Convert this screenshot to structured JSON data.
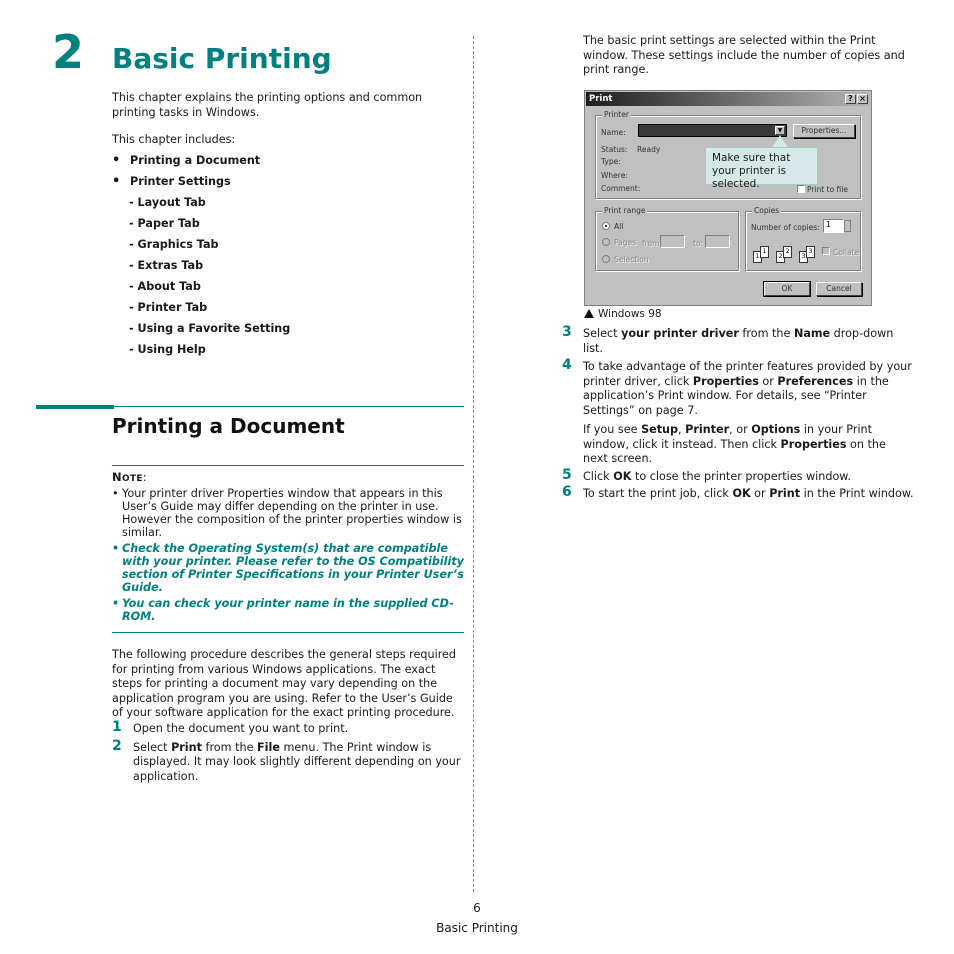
{
  "chapter": {
    "number": "2",
    "title": "Basic Printing",
    "intro": "This chapter explains the printing options and common printing tasks in Windows.",
    "includes_label": "This chapter includes:",
    "toc": [
      {
        "label": "Printing a Document",
        "level": 1
      },
      {
        "label": "Printer Settings",
        "level": 1
      },
      {
        "label": "- Layout Tab",
        "level": 2
      },
      {
        "label": "- Paper Tab",
        "level": 2
      },
      {
        "label": "- Graphics Tab",
        "level": 2
      },
      {
        "label": "- Extras Tab",
        "level": 2
      },
      {
        "label": "- About Tab",
        "level": 2
      },
      {
        "label": "- Printer Tab",
        "level": 2
      },
      {
        "label": "- Using a Favorite Setting",
        "level": 2
      },
      {
        "label": "- Using Help",
        "level": 2
      }
    ]
  },
  "section": {
    "title": "Printing a Document",
    "note": {
      "label_first": "N",
      "label_rest": "OTE",
      "label_colon": ":",
      "items": [
        {
          "text": "Your printer driver Properties window that appears in this User’s Guide may differ depending on the printer in use. However the composition of the printer properties window is similar.",
          "emphasis": false
        },
        {
          "text": "Check the Operating System(s) that are compatible with your printer. Please refer to the OS Compatibility section of Printer Specifications in your Printer User’s Guide.",
          "emphasis": true
        },
        {
          "text": "You can check your printer name in the supplied CD-ROM.",
          "emphasis": true
        }
      ]
    },
    "procedure_intro": "The following procedure describes the general steps required for printing from various Windows applications. The exact steps for printing a document may vary depending on the application program you are using. Refer to the User’s Guide of your software application for the exact printing procedure.",
    "steps": {
      "s1": {
        "num": "1",
        "text": "Open the document you want to print."
      },
      "s2": {
        "num": "2",
        "a": "Select ",
        "b": "Print",
        "c": " from the ",
        "d": "File",
        "e": " menu. The Print window is displayed. It may look slightly different depending on your application."
      },
      "s3": {
        "num": "3",
        "a": "Select ",
        "b": "your printer driver",
        "c": " from the ",
        "d": "Name",
        "e": " drop-down list."
      },
      "s4": {
        "num": "4",
        "a": "To take advantage of the printer features provided by your printer driver, click ",
        "b": "Properties",
        "c": " or ",
        "d": "Preferences",
        "e": " in the application’s Print window. For details, see “Printer Settings” on page 7."
      },
      "s4b": {
        "a": "If you see ",
        "b": "Setup",
        "c": ", ",
        "d": "Printer",
        "e": ", or ",
        "f": "Options",
        "g": " in your Print window, click it instead. Then click ",
        "h": "Properties",
        "i": " on the next screen."
      },
      "s5": {
        "num": "5",
        "a": "Click ",
        "b": "OK",
        "c": " to close the printer properties window."
      },
      "s6": {
        "num": "6",
        "a": "To start the print job, click ",
        "b": "OK",
        "c": " or ",
        "d": "Print",
        "e": " in the Print window."
      }
    }
  },
  "right_intro": "The basic print settings are selected within the Print window. These settings include the number of copies and print range.",
  "dialog": {
    "title": "Print",
    "help_btn": "?",
    "close_btn": "×",
    "printer_group": "Printer",
    "name_label": "Name:",
    "properties_btn": "Properties...",
    "status_label": "Status:",
    "status_value": "Ready",
    "type_label": "Type:",
    "where_label": "Where:",
    "comment_label": "Comment:",
    "print_to_file": "Print to file",
    "range_group": "Print range",
    "range_all": "All",
    "range_pages": "Pages",
    "from_label": "from:",
    "to_label": "to:",
    "range_selection": "Selection",
    "copies_group": "Copies",
    "copies_label": "Number of copies:",
    "copies_value": "1",
    "collate_label": "Collate",
    "page_icons": [
      "1",
      "1",
      "2",
      "2",
      "3",
      "3"
    ],
    "ok_btn": "OK",
    "cancel_btn": "Cancel"
  },
  "callout": "Make sure that your printer is selected.",
  "caption": "Windows 98",
  "footer": {
    "page_number": "6",
    "chapter_name": "Basic Printing"
  },
  "colors": {
    "accent": "#00807f",
    "callout_bg": "#d6e9e9"
  }
}
